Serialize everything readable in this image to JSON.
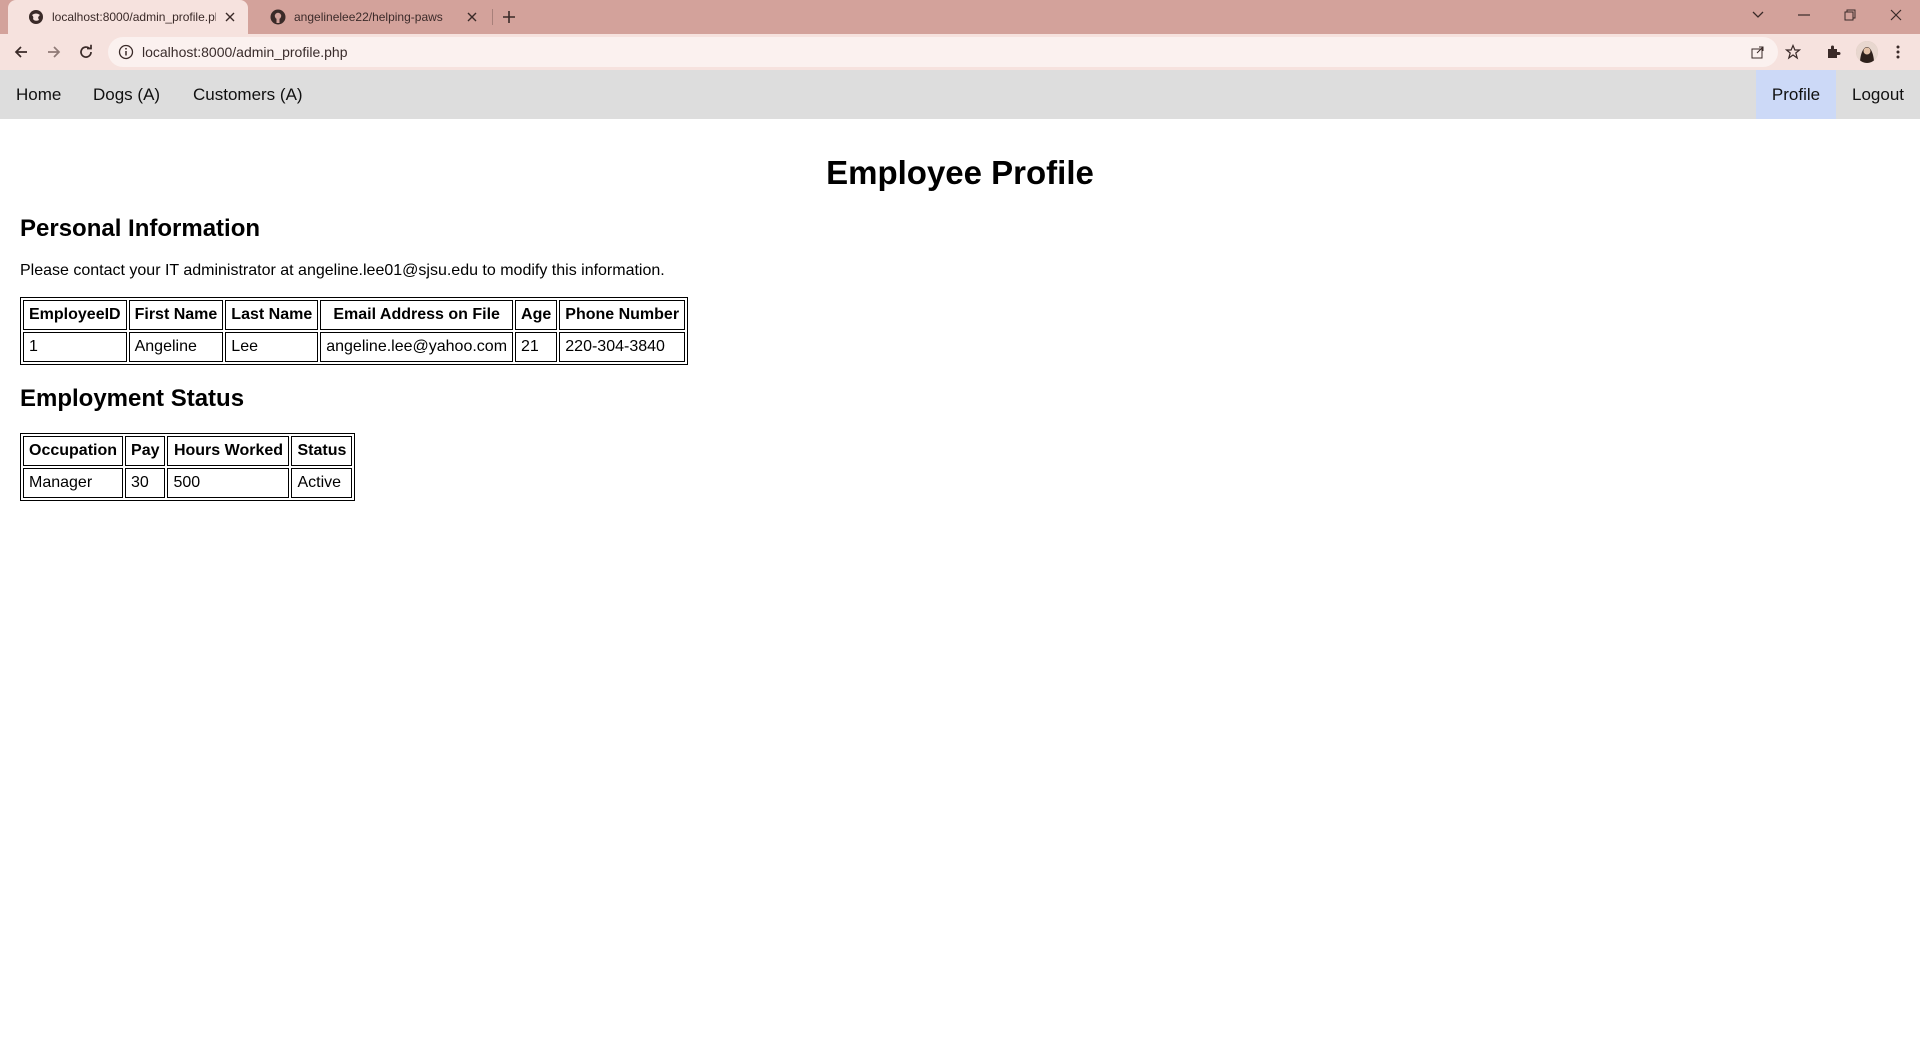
{
  "browser": {
    "tabs": [
      {
        "title": "localhost:8000/admin_profile.php",
        "active": true
      },
      {
        "title": "angelinelee22/helping-paws",
        "active": false
      }
    ],
    "url": "localhost:8000/admin_profile.php",
    "colors": {
      "tabstrip": "#d3a29b",
      "toolbar": "#f6e2de"
    }
  },
  "nav": {
    "left": [
      "Home",
      "Dogs (A)",
      "Customers (A)"
    ],
    "profile": "Profile",
    "logout": "Logout"
  },
  "page": {
    "title": "Employee Profile",
    "personal": {
      "heading": "Personal Information",
      "note": "Please contact your IT administrator at angeline.lee01@sjsu.edu to modify this information.",
      "headers": [
        "EmployeeID",
        "First Name",
        "Last Name",
        "Email Address on File",
        "Age",
        "Phone Number"
      ],
      "rows": [
        [
          "1",
          "Angeline",
          "Lee",
          "angeline.lee@yahoo.com",
          "21",
          "220-304-3840"
        ]
      ]
    },
    "employment": {
      "heading": "Employment Status",
      "headers": [
        "Occupation",
        "Pay",
        "Hours Worked",
        "Status"
      ],
      "rows": [
        [
          "Manager",
          "30",
          "500",
          "Active"
        ]
      ]
    }
  }
}
